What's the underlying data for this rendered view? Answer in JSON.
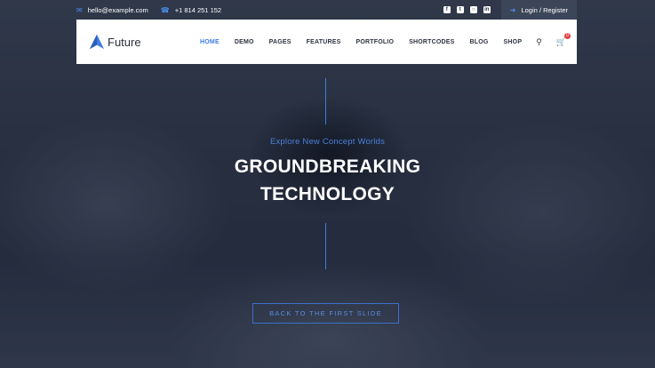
{
  "topbar": {
    "email": "hello@example.com",
    "email_icon": "envelope-icon",
    "phone": "+1 814 251 152",
    "phone_icon": "phone-icon",
    "socials": [
      "facebook-icon",
      "twitter-icon",
      "instagram-icon",
      "linkedin-icon"
    ],
    "login_label": "Login / Register",
    "login_icon": "login-icon"
  },
  "nav": {
    "brand": "Future",
    "menu": [
      "HOME",
      "DEMO",
      "PAGES",
      "FEATURES",
      "PORTFOLIO",
      "SHORTCODES",
      "BLOG",
      "SHOP"
    ],
    "active_item": "HOME",
    "cart_count": "0",
    "accent_color": "#3d7de0"
  },
  "hero": {
    "subtitle": "Explore New Concept Worlds",
    "headline_line1": "GROUNDBREAKING",
    "headline_line2": "TECHNOLOGY",
    "cta_label": "BACK TO THE FIRST SLIDE"
  }
}
